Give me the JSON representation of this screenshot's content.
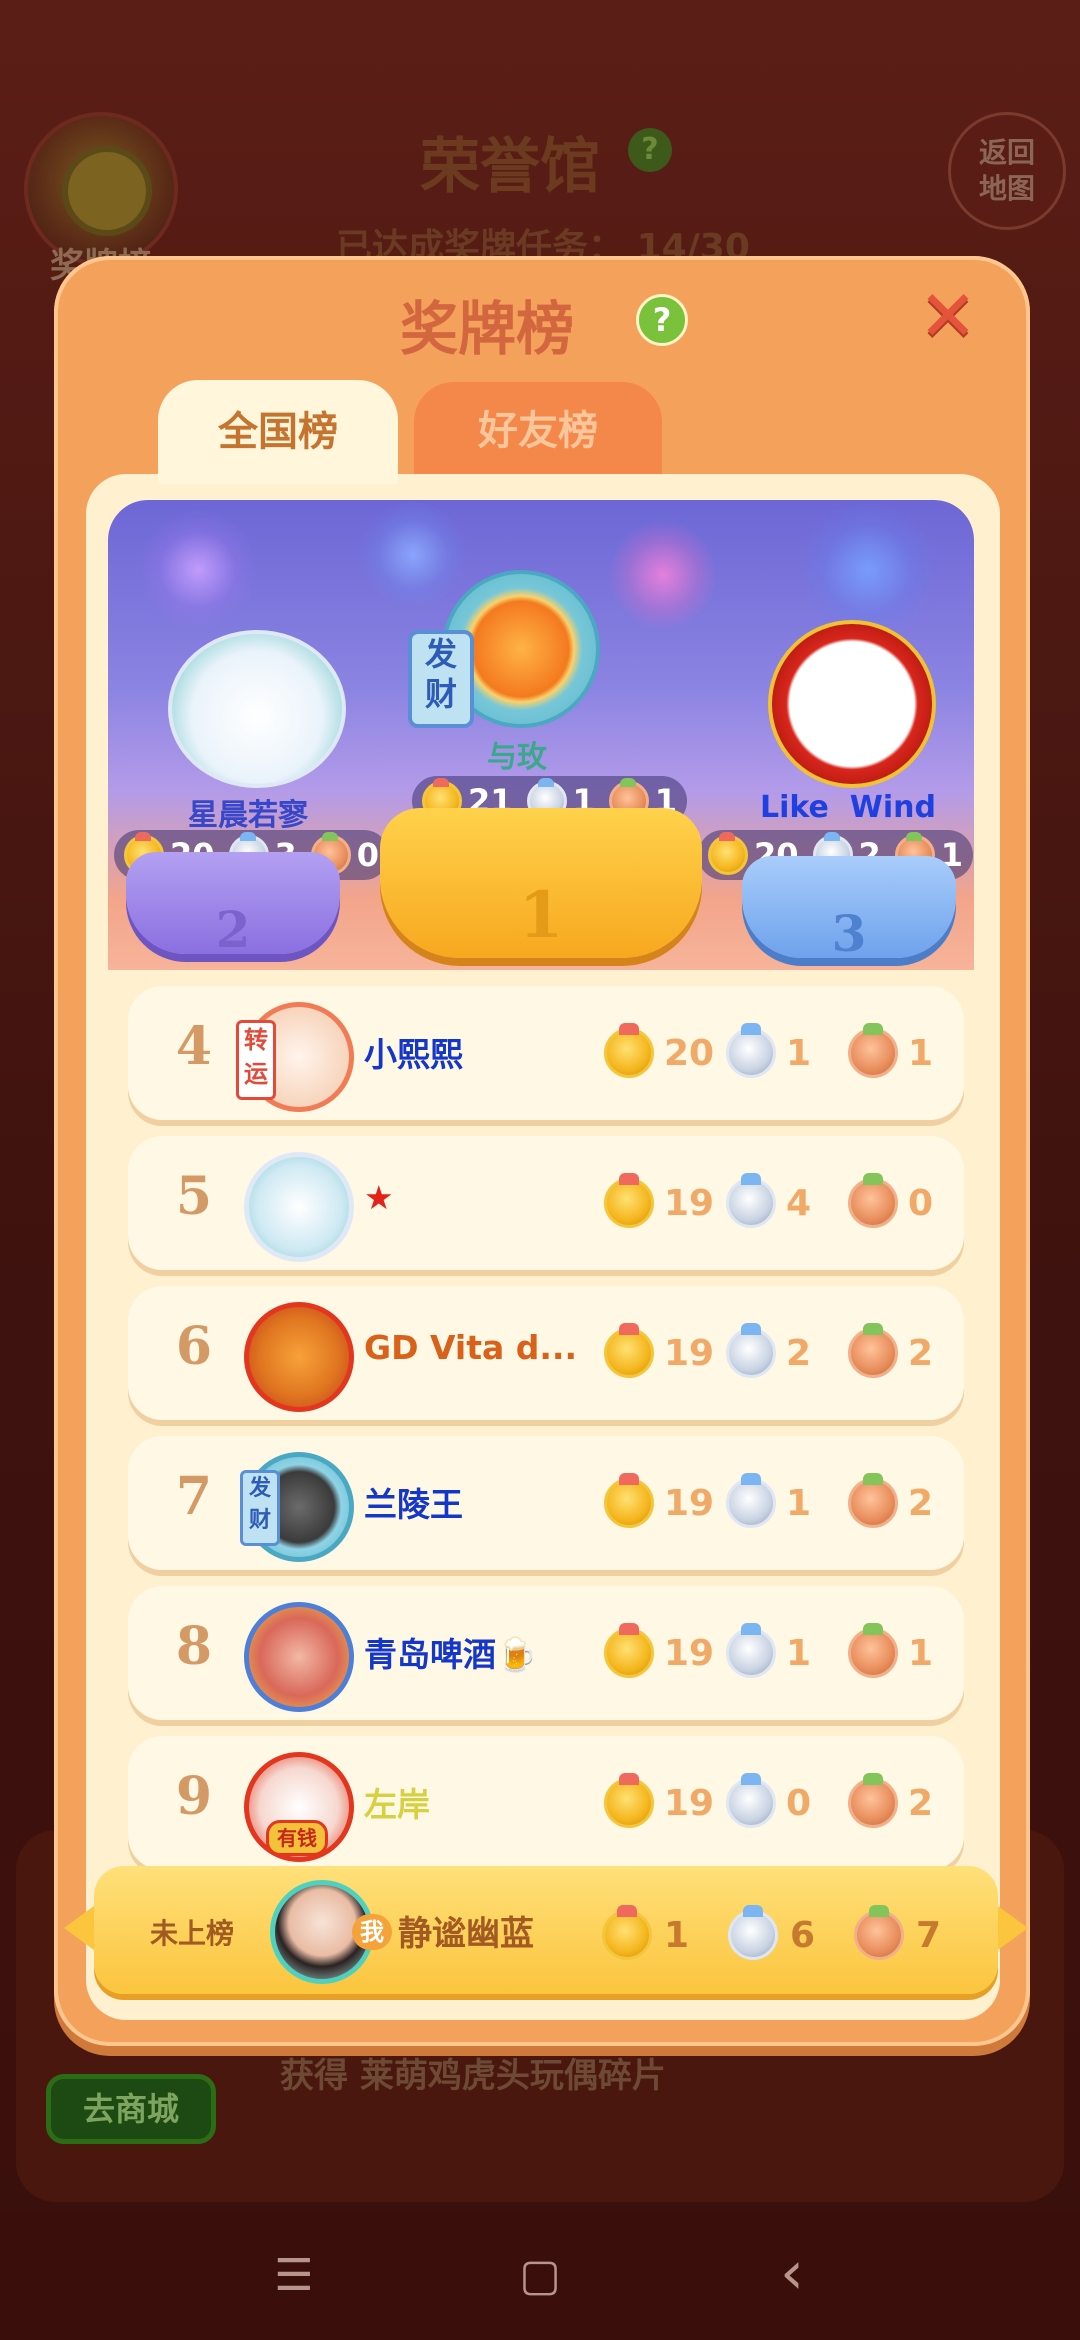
{
  "background": {
    "medal_button_label": "奖牌榜",
    "title": "荣誉馆",
    "subtitle_label": "已达成奖牌任务：",
    "subtitle_value": "14/30",
    "return_button": "返回\n地图",
    "shop_button": "去商城",
    "reward_text": "获得 莱萌鸡虎头玩偶碎片"
  },
  "modal": {
    "title": "奖牌榜",
    "help_icon": "?",
    "close_icon": "✕",
    "tabs": [
      {
        "label": "全国榜",
        "active": true
      },
      {
        "label": "好友榜",
        "active": false
      }
    ]
  },
  "podium": [
    {
      "rank": "1",
      "name": "与玫",
      "gold": "21",
      "silver": "1",
      "bronze": "1",
      "name_color": "#3aa88b",
      "badge": "发财"
    },
    {
      "rank": "2",
      "name": "星晨若寥",
      "gold": "20",
      "silver": "3",
      "bronze": "0",
      "name_color": "#3747c8"
    },
    {
      "rank": "3",
      "name": "Like  Wind",
      "gold": "20",
      "silver": "2",
      "bronze": "1",
      "name_color": "#1f3fe0"
    }
  ],
  "rows": [
    {
      "rank": "4",
      "name": "小熙熙",
      "gold": "20",
      "silver": "1",
      "bronze": "1",
      "name_color": "#1537c9",
      "badge": "转运"
    },
    {
      "rank": "5",
      "name": "★",
      "gold": "19",
      "silver": "4",
      "bronze": "0",
      "name_color": "#e3221a"
    },
    {
      "rank": "6",
      "name": "GD Vita d...",
      "gold": "19",
      "silver": "2",
      "bronze": "2",
      "name_color": "#d8621a"
    },
    {
      "rank": "7",
      "name": "兰陵王",
      "gold": "19",
      "silver": "1",
      "bronze": "2",
      "name_color": "#1537c9",
      "badge": "发财"
    },
    {
      "rank": "8",
      "name": "青岛啤酒🍺",
      "gold": "19",
      "silver": "1",
      "bronze": "1",
      "name_color": "#1537c9"
    },
    {
      "rank": "9",
      "name": "左岸",
      "gold": "19",
      "silver": "0",
      "bronze": "2",
      "name_color": "#d7d040",
      "badge": "有钱"
    }
  ],
  "me": {
    "status": "未上榜",
    "badge": "我",
    "name": "静谧幽蓝",
    "gold": "1",
    "silver": "6",
    "bronze": "7"
  },
  "navbar": {
    "menu_icon": "☰",
    "home_icon": "▢",
    "back_icon": "‹"
  }
}
